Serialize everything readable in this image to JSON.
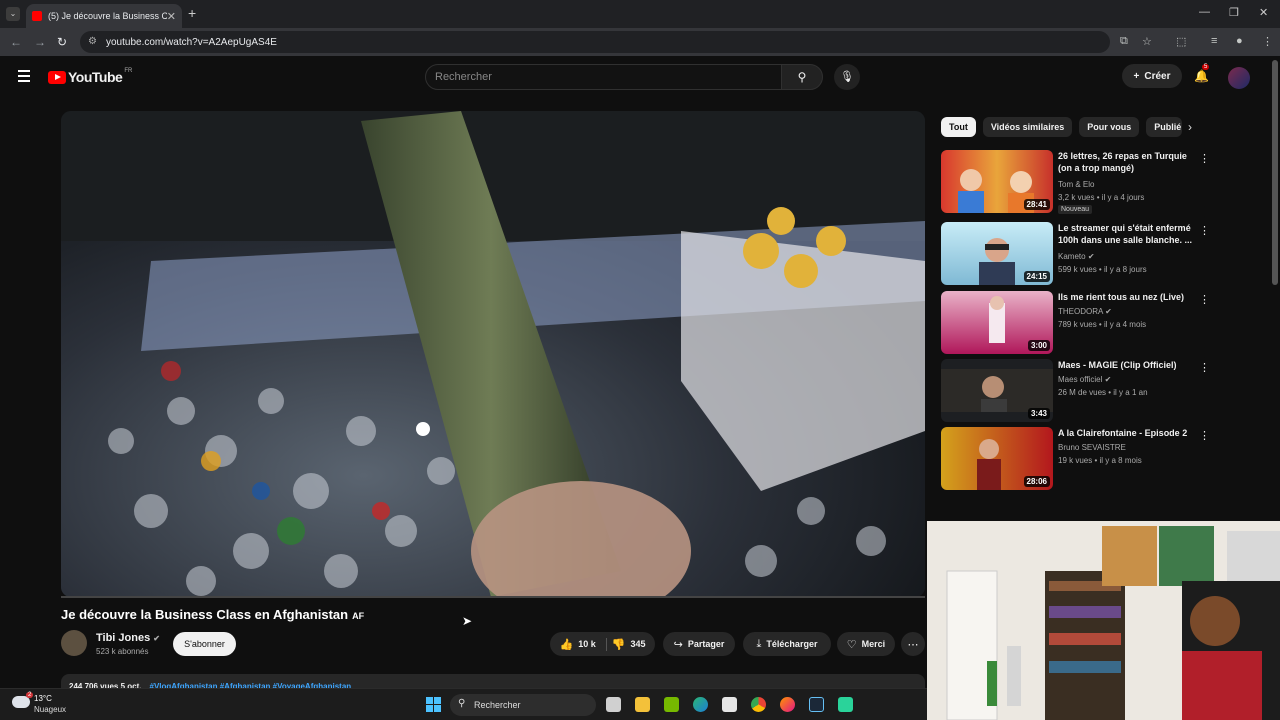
{
  "browser": {
    "tab_title": "(5) Je découvre la Business C",
    "tab_close": "✕",
    "new_tab": "+",
    "url": "youtube.com/watch?v=A2AepUgAS4E"
  },
  "youtube": {
    "country": "FR",
    "logo_text": "YouTube",
    "search_placeholder": "Rechercher",
    "create_label": "Créer",
    "notif_count": "5"
  },
  "video": {
    "title": "Je découvre la Business Class en Afghanistan",
    "title_flag": "AF",
    "channel_name": "Tibi Jones",
    "subscribers": "523 k abonnés",
    "subscribe_label": "S'abonner",
    "likes": "10 k",
    "dislikes": "345",
    "share_label": "Partager",
    "download_label": "Télécharger",
    "thanks_label": "Merci",
    "views_date": "244 706 vues  5 oct.",
    "hashtags": "#VlogAfghanistan #Afghanistan #VoyageAfghanistan"
  },
  "chips": [
    "Tout",
    "Vidéos similaires",
    "Pour vous",
    "Publié"
  ],
  "recommendations": [
    {
      "title": "26 lettres, 26 repas en Turquie (on a trop mangé)",
      "channel": "Tom & Elo",
      "meta": "3,2 k vues • il y a 4 jours",
      "duration": "28:41",
      "badge": "Nouveau"
    },
    {
      "title": "Le streamer qui s'était enfermé 100h dans une salle blanche. ...",
      "channel": "Kameto",
      "meta": "599 k vues • il y a 8 jours",
      "duration": "24:15"
    },
    {
      "title": "Ils me rient tous au nez (Live)",
      "channel": "THEODORA",
      "meta": "789 k vues • il y a 4 mois",
      "duration": "3:00"
    },
    {
      "title": "Maes - MAGIE (Clip Officiel)",
      "channel": "Maes officiel",
      "meta": "26 M de vues • il y a 1 an",
      "duration": "3:43"
    },
    {
      "title": "A la Clairefontaine - Episode 2",
      "channel": "Bruno SEVAISTRE",
      "meta": "19 k vues • il y a 8 mois",
      "duration": "28:06"
    }
  ],
  "taskbar": {
    "temperature": "13°C",
    "condition": "Nuageux",
    "weather_badge": "2",
    "search_label": "Rechercher"
  },
  "colors": {
    "yt_red": "#ff0000",
    "bg": "#0f0f0f",
    "chip_bg": "#272727",
    "link": "#3ea6ff"
  }
}
